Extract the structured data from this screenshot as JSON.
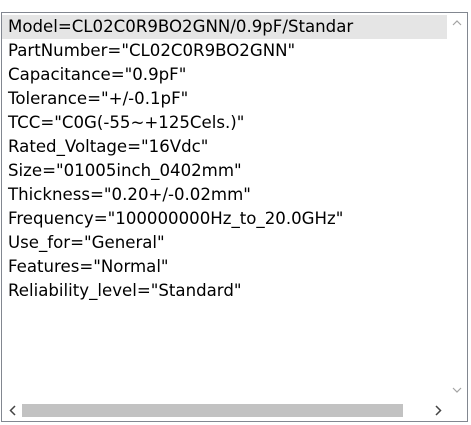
{
  "listbox": {
    "items": [
      "Model=CL02C0R9BO2GNN/0.9pF/Standar",
      "PartNumber=\"CL02C0R9BO2GNN\"",
      "Capacitance=\"0.9pF\"",
      "Tolerance=\"+/-0.1pF\"",
      "TCC=\"C0G(-55~+125Cels.)\"",
      "Rated_Voltage=\"16Vdc\"",
      "Size=\"01005inch_0402mm\"",
      "Thickness=\"0.20+/-0.02mm\"",
      "Frequency=\"100000000Hz_to_20.0GHz\"",
      "Use_for=\"General\"",
      "Features=\"Normal\"",
      "Reliability_level=\"Standard\""
    ],
    "selected_index": 0
  },
  "scrollbars": {
    "vertical_icons": [
      "chevron-up-icon",
      "chevron-down-icon"
    ],
    "horizontal_icons": [
      "chevron-left-icon",
      "chevron-right-icon"
    ],
    "horizontal_thumb_fraction": 0.9
  },
  "colors": {
    "selection": "#e5e5e5",
    "border": "#828790",
    "thumb": "#c2c2c2"
  }
}
